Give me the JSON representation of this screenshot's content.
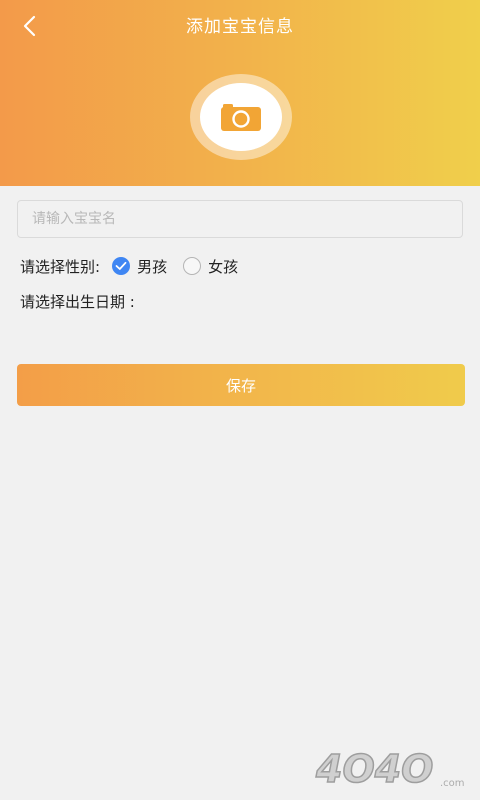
{
  "header": {
    "title": "添加宝宝信息",
    "back_icon": "chevron-left-icon",
    "gradient_colors": [
      "#f39a4a",
      "#f0cf4b"
    ]
  },
  "avatar": {
    "icon": "camera-icon",
    "icon_color": "#f2a535"
  },
  "form": {
    "name_placeholder": "请输入宝宝名",
    "name_value": "",
    "gender_label": "请选择性别:",
    "gender_options": [
      {
        "label": "男孩",
        "selected": true
      },
      {
        "label": "女孩",
        "selected": false
      }
    ],
    "birth_label": "请选择出生日期 :"
  },
  "actions": {
    "save_label": "保存"
  },
  "watermark": {
    "text": "4O4O"
  }
}
